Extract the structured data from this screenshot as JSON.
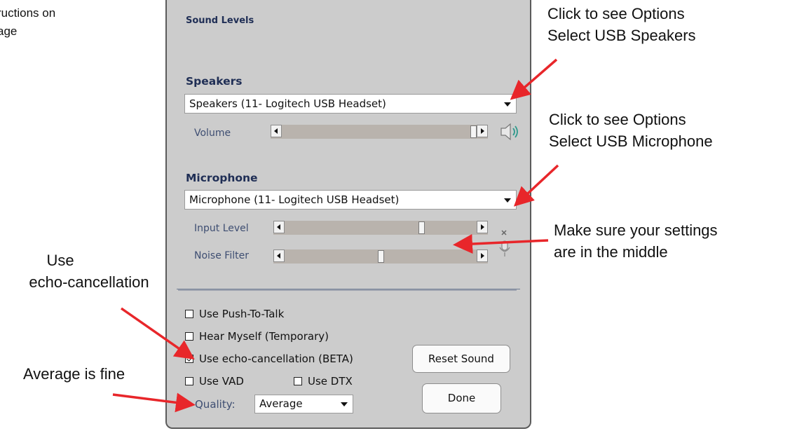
{
  "page_note": {
    "line1": "ructions on",
    "line2": "age"
  },
  "dialog": {
    "title": "Sound Levels",
    "speakers": {
      "heading": "Speakers",
      "device": "Speakers (11- Logitech USB Headset)",
      "volume_label": "Volume",
      "volume_level": 1.0
    },
    "microphone": {
      "heading": "Microphone",
      "device": "Microphone (11- Logitech USB Headset)",
      "input_level_label": "Input Level",
      "input_level": 0.72,
      "noise_filter_label": "Noise Filter",
      "noise_filter": 0.5
    },
    "options": {
      "push_to_talk": {
        "label": "Use Push-To-Talk",
        "checked": false
      },
      "hear_myself": {
        "label": "Hear Myself (Temporary)",
        "checked": false
      },
      "echo_cancellation": {
        "label": "Use echo-cancellation (BETA)",
        "checked": true
      },
      "use_vad": {
        "label": "Use VAD",
        "checked": false
      },
      "use_dtx": {
        "label": "Use DTX",
        "checked": false
      }
    },
    "quality": {
      "label": "Quality:",
      "value": "Average"
    },
    "buttons": {
      "reset_sound": "Reset Sound",
      "done": "Done"
    }
  },
  "annotations": {
    "speakers_hint": {
      "line1": "Click to see Options",
      "line2": "Select USB Speakers"
    },
    "microphone_hint": {
      "line1": "Click to see Options",
      "line2": "Select USB Microphone"
    },
    "settings_hint": {
      "line1": "Make sure your settings",
      "line2": "are in the middle"
    },
    "echo_hint": {
      "line1": "Use",
      "line2": "echo-cancellation"
    },
    "quality_hint": "Average is fine",
    "arrow_color": "#e8262a"
  },
  "icons": {
    "speaker": "speaker-volume-icon",
    "microphone": "microphone-muted-icon",
    "dropdown": "chevron-down-icon"
  }
}
